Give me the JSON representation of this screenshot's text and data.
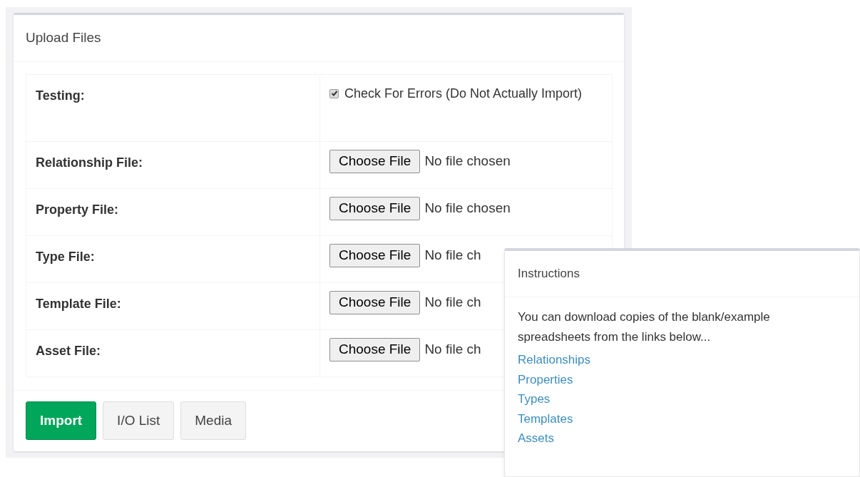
{
  "upload_panel": {
    "title": "Upload Files",
    "rows": [
      {
        "kind": "checkbox",
        "label": "Testing:",
        "option": "Check For Errors (Do Not Actually Import)",
        "checked": true
      },
      {
        "kind": "file",
        "label": "Relationship File:",
        "button": "Choose File",
        "status": "No file chosen"
      },
      {
        "kind": "file",
        "label": "Property File:",
        "button": "Choose File",
        "status": "No file chosen"
      },
      {
        "kind": "file",
        "label": "Type File:",
        "button": "Choose File",
        "status": "No file ch"
      },
      {
        "kind": "file",
        "label": "Template File:",
        "button": "Choose File",
        "status": "No file ch"
      },
      {
        "kind": "file",
        "label": "Asset File:",
        "button": "Choose File",
        "status": "No file ch"
      }
    ],
    "buttons": [
      {
        "label": "Import",
        "kind": "primary"
      },
      {
        "label": "I/O List",
        "kind": "default"
      },
      {
        "label": "Media",
        "kind": "default"
      }
    ]
  },
  "instructions_panel": {
    "title": "Instructions",
    "text": "You can download copies of the blank/example spreadsheets from the links below...",
    "links": [
      "Relationships",
      "Properties",
      "Types",
      "Templates",
      "Assets"
    ]
  }
}
